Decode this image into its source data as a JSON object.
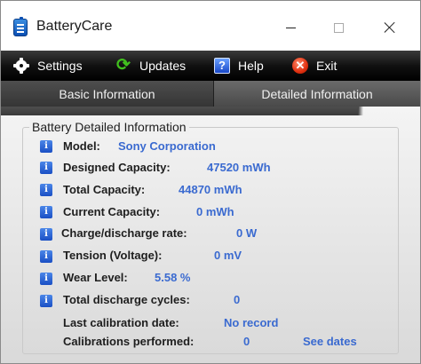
{
  "window": {
    "title": "BatteryCare",
    "minimize_icon": "minimize-icon",
    "maximize_icon": "maximize-icon",
    "close_icon": "close-icon"
  },
  "toolbar": {
    "settings_label": "Settings",
    "updates_label": "Updates",
    "help_label": "Help",
    "exit_label": "Exit",
    "help_glyph": "?",
    "exit_glyph": "✕"
  },
  "tabs": {
    "basic_label": "Basic Information",
    "detailed_label": "Detailed Information"
  },
  "details": {
    "group_title": "Battery Detailed Information",
    "info_glyph": "i",
    "rows": [
      {
        "label": "Model:",
        "value": "Sony Corporation"
      },
      {
        "label": "Designed Capacity:",
        "value": "47520 mWh"
      },
      {
        "label": "Total Capacity:",
        "value": "44870 mWh"
      },
      {
        "label": "Current Capacity:",
        "value": "0 mWh"
      },
      {
        "label": "Charge/discharge rate:",
        "value": "0 W"
      },
      {
        "label": "Tension (Voltage):",
        "value": "0 mV"
      },
      {
        "label": "Wear Level:",
        "value": "5.58 %"
      },
      {
        "label": "Total discharge cycles:",
        "value": "0"
      }
    ],
    "last_calibration_label": "Last calibration date:",
    "last_calibration_value": "No record",
    "calibrations_label": "Calibrations performed:",
    "calibrations_value": "0",
    "see_dates_link": "See dates"
  },
  "colors": {
    "value_blue": "#3a6ad0",
    "toolbar_bg": "#111111",
    "tab_bg": "#4a4a4a"
  }
}
